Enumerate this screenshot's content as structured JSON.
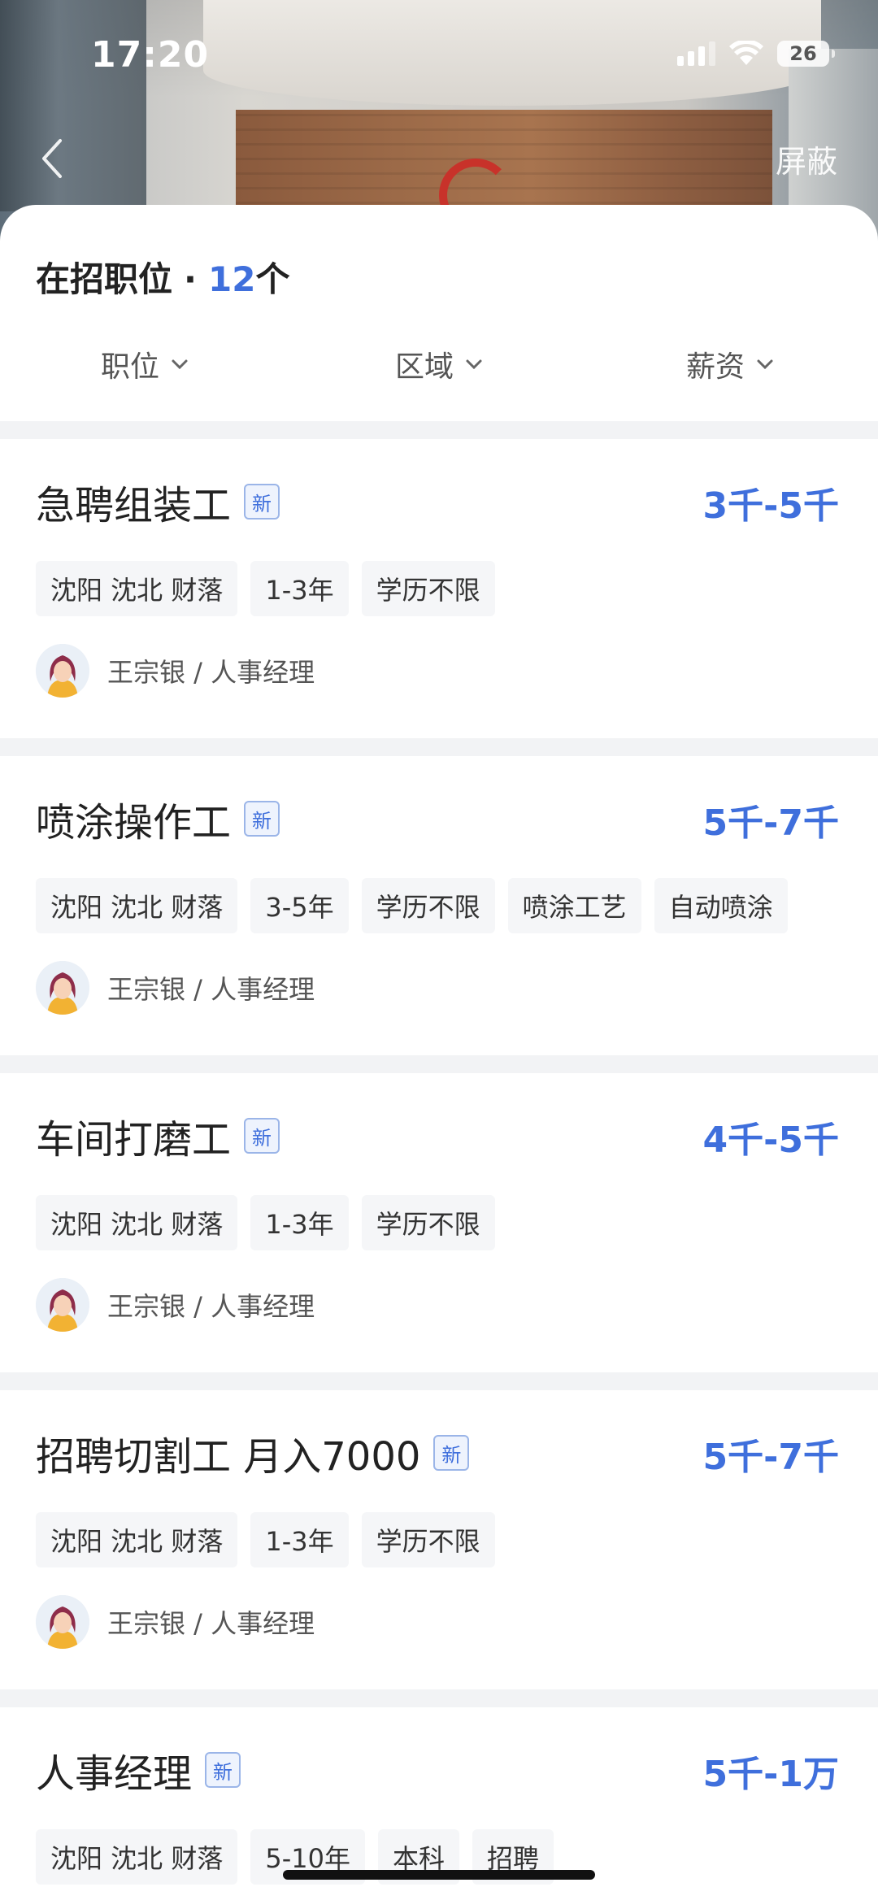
{
  "status_bar": {
    "time": "17:20",
    "battery": "26"
  },
  "nav": {
    "block_label": "屏蔽"
  },
  "header": {
    "title": "在招职位",
    "separator": "·",
    "count": "12",
    "count_unit": "个"
  },
  "filters": [
    {
      "label": "职位"
    },
    {
      "label": "区域"
    },
    {
      "label": "薪资"
    }
  ],
  "jobs": [
    {
      "title": "急聘组装工",
      "badge": "新",
      "salary": "3千-5千",
      "tags": [
        "沈阳 沈北 财落",
        "1-3年",
        "学历不限"
      ],
      "recruiter": "王宗银 / 人事经理"
    },
    {
      "title": "喷涂操作工",
      "badge": "新",
      "salary": "5千-7千",
      "tags": [
        "沈阳 沈北 财落",
        "3-5年",
        "学历不限",
        "喷涂工艺",
        "自动喷涂"
      ],
      "recruiter": "王宗银 / 人事经理"
    },
    {
      "title": "车间打磨工",
      "badge": "新",
      "salary": "4千-5千",
      "tags": [
        "沈阳 沈北 财落",
        "1-3年",
        "学历不限"
      ],
      "recruiter": "王宗银 / 人事经理"
    },
    {
      "title": "招聘切割工 月入7000",
      "badge": "新",
      "salary": "5千-7千",
      "tags": [
        "沈阳 沈北 财落",
        "1-3年",
        "学历不限"
      ],
      "recruiter": "王宗银 / 人事经理"
    },
    {
      "title": "人事经理",
      "badge": "新",
      "salary": "5千-1万",
      "tags": [
        "沈阳 沈北 财落",
        "5-10年",
        "本科",
        "招聘"
      ],
      "recruiter": ""
    }
  ],
  "colors": {
    "accent": "#3f6fdc",
    "tag_bg": "#f5f6f8",
    "band": "#f2f3f5"
  },
  "icons": [
    "back-chevron-icon",
    "signal-icon",
    "wifi-icon",
    "battery-icon",
    "chevron-down-icon",
    "avatar-icon"
  ]
}
